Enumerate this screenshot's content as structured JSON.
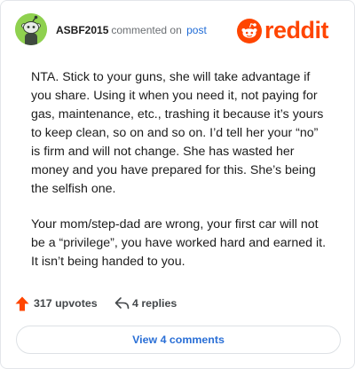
{
  "comment": {
    "username": "ASBF2015",
    "action_text": "commented on",
    "target_link": "post",
    "paragraphs": [
      "NTA. Stick to your guns, she will take advantage if you share. Using it when you need it, not paying for gas, maintenance, etc., trashing it because it’s yours to keep clean, so on and so on. I’d tell her your “no” is firm and will not change. She has wasted her money and you have prepared for this. She’s being the selfish one.",
      "Your mom/step-dad are wrong, your first car will not be a “privilege”, you have worked hard and earned it. It isn’t being handed to you."
    ]
  },
  "brand": {
    "wordmark": "reddit",
    "color": "#ff4500"
  },
  "stats": {
    "upvotes": "317 upvotes",
    "replies": "4 replies"
  },
  "footer": {
    "view_comments_label": "View 4 comments"
  },
  "colors": {
    "avatar_bg": "#8fd14f",
    "upvote_arrow": "#ff4500",
    "link_blue": "#1f6bd6"
  },
  "icons": {
    "avatar": "reddit-snoo-avatar-icon",
    "brand": "reddit-logo-icon",
    "upvote": "upvote-arrow-icon",
    "reply": "reply-arrow-icon"
  }
}
